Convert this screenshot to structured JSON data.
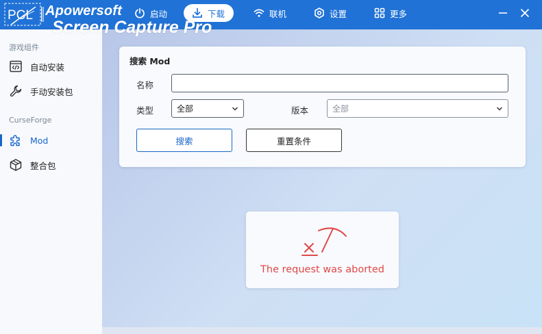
{
  "app": {
    "logo_text": "PCL",
    "watermark_line1": "Apowersoft",
    "watermark_line2": "Screen Capture Pro"
  },
  "nav": [
    {
      "label": "启动",
      "icon": "power-icon"
    },
    {
      "label": "下载",
      "icon": "download-icon",
      "active": true
    },
    {
      "label": "联机",
      "icon": "wifi-icon"
    },
    {
      "label": "设置",
      "icon": "settings-icon"
    },
    {
      "label": "更多",
      "icon": "grid-icon"
    }
  ],
  "window_controls": {
    "minimize": "minimize-icon",
    "close": "close-icon"
  },
  "sidebar": {
    "group1_title": "游戏组件",
    "group1_items": [
      {
        "label": "自动安装",
        "icon": "code-icon"
      },
      {
        "label": "手动安装包",
        "icon": "wrench-icon"
      }
    ],
    "group2_title": "CurseForge",
    "group2_items": [
      {
        "label": "Mod",
        "icon": "puzzle-icon",
        "active": true
      },
      {
        "label": "整合包",
        "icon": "box-icon"
      }
    ]
  },
  "search": {
    "title": "搜索 Mod",
    "name_label": "名称",
    "name_value": "",
    "type_label": "类型",
    "type_value": "全部",
    "version_label": "版本",
    "version_value": "全部",
    "search_button": "搜索",
    "reset_button": "重置条件"
  },
  "error": {
    "message": "The request was aborted",
    "icon": "broken-pickaxe-icon"
  },
  "colors": {
    "accent": "#2072d6",
    "error": "#e04848"
  }
}
